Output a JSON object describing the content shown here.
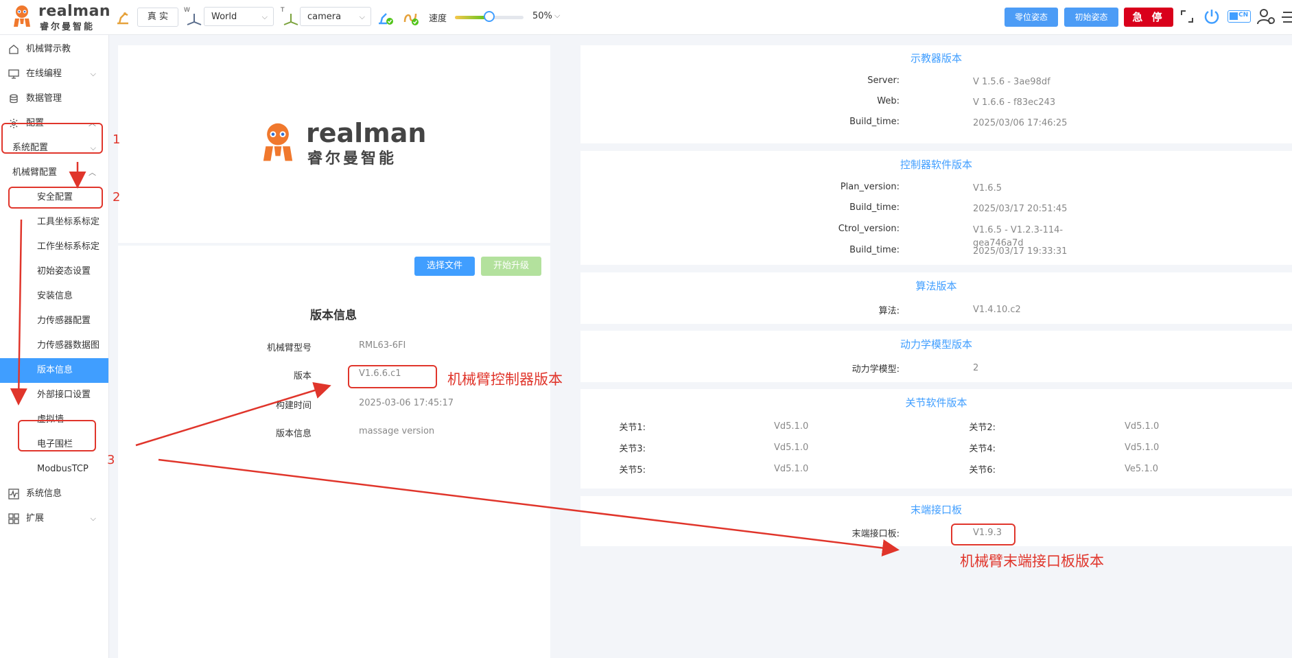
{
  "header": {
    "brand_en": "realman",
    "brand_cn": "睿尔曼智能",
    "mode_button": "真 实",
    "coord_prefix_w": "W",
    "coord_select": "World",
    "coord_prefix_t": "T",
    "tool_select": "camera",
    "speed_label": "速度",
    "speed_value": "50%",
    "speed_level": 0.5,
    "zero_pose_button": "零位姿态",
    "init_pose_button": "初始姿态",
    "estop_button": "急 停",
    "lang_badge": "CN"
  },
  "sidebar": {
    "items": [
      {
        "label": "机械臂示教",
        "icon": "home-icon"
      },
      {
        "label": "在线编程",
        "icon": "monitor-icon"
      },
      {
        "label": "数据管理",
        "icon": "database-icon"
      },
      {
        "label": "配置",
        "icon": "settings-icon"
      },
      {
        "label": "系统配置"
      },
      {
        "label": "机械臂配置"
      },
      {
        "label": "安全配置"
      },
      {
        "label": "工具坐标系标定"
      },
      {
        "label": "工作坐标系标定"
      },
      {
        "label": "初始姿态设置"
      },
      {
        "label": "安装信息"
      },
      {
        "label": "力传感器配置"
      },
      {
        "label": "力传感器数据图"
      },
      {
        "label": "版本信息"
      },
      {
        "label": "外部接口设置"
      },
      {
        "label": "虚拟墙"
      },
      {
        "label": "电子围栏"
      },
      {
        "label": "ModbusTCP"
      },
      {
        "label": "系统信息",
        "icon": "waveform-icon"
      },
      {
        "label": "扩展",
        "icon": "grid-icon"
      }
    ]
  },
  "upgrade": {
    "choose_file": "选择文件",
    "start_upgrade": "开始升级"
  },
  "version_info": {
    "title": "版本信息",
    "rows": [
      {
        "label": "机械臂型号",
        "value": "RML63-6FI"
      },
      {
        "label": "版本",
        "value": "V1.6.6.c1"
      },
      {
        "label": "构建时间",
        "value": "2025-03-06 17:45:17"
      },
      {
        "label": "版本信息",
        "value": "massage version"
      }
    ]
  },
  "teach_pendant": {
    "title": "示教器版本",
    "rows": [
      {
        "label": "Server:",
        "value": "V 1.5.6 - 3ae98df"
      },
      {
        "label": "Web:",
        "value": "V 1.6.6 - f83ec243"
      },
      {
        "label": "Build_time:",
        "value": "2025/03/06 17:46:25"
      }
    ]
  },
  "controller": {
    "title": "控制器软件版本",
    "rows": [
      {
        "label": "Plan_version:",
        "value": "V1.6.5"
      },
      {
        "label": "Build_time:",
        "value": "2025/03/17 20:51:45"
      },
      {
        "label": "Ctrol_version:",
        "value": "V1.6.5 - V1.2.3-114-gea746a7d"
      },
      {
        "label": "Build_time:",
        "value": "2025/03/17 19:33:31"
      }
    ]
  },
  "algorithm": {
    "title": "算法版本",
    "rows": [
      {
        "label": "算法:",
        "value": "V1.4.10.c2"
      }
    ]
  },
  "dynamics": {
    "title": "动力学模型版本",
    "rows": [
      {
        "label": "动力学模型:",
        "value": "2"
      }
    ]
  },
  "joints": {
    "title": "关节软件版本",
    "rows": [
      {
        "label": "关节1:",
        "value": "Vd5.1.0"
      },
      {
        "label": "关节2:",
        "value": "Vd5.1.0"
      },
      {
        "label": "关节3:",
        "value": "Vd5.1.0"
      },
      {
        "label": "关节4:",
        "value": "Vd5.1.0"
      },
      {
        "label": "关节5:",
        "value": "Vd5.1.0"
      },
      {
        "label": "关节6:",
        "value": "Ve5.1.0"
      }
    ]
  },
  "end_board": {
    "title": "末端接口板",
    "rows": [
      {
        "label": "末端接口板:",
        "value": "V1.9.3"
      }
    ]
  },
  "annotations": {
    "step1": "1",
    "step2": "2",
    "step3": "3",
    "controller_note": "机械臂控制器版本",
    "end_board_note": "机械臂末端接口板版本",
    "color": "#e0352b"
  },
  "colors": {
    "accent": "#409eff",
    "estop": "#d9001b",
    "brand_orange": "#f0782d"
  }
}
